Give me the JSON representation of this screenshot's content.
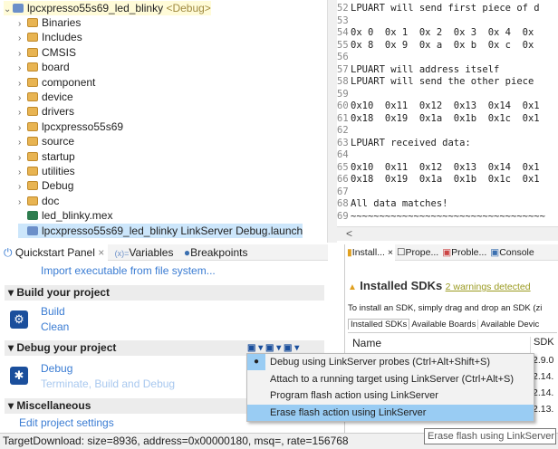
{
  "tree": {
    "project": "lpcxpresso55s69_led_blinky",
    "project_config": "<Debug>",
    "items": [
      {
        "label": "Binaries",
        "expandable": true
      },
      {
        "label": "Includes",
        "expandable": true
      },
      {
        "label": "CMSIS",
        "expandable": true
      },
      {
        "label": "board",
        "expandable": true
      },
      {
        "label": "component",
        "expandable": true
      },
      {
        "label": "device",
        "expandable": true
      },
      {
        "label": "drivers",
        "expandable": true
      },
      {
        "label": "lpcxpresso55s69",
        "expandable": true
      },
      {
        "label": "source",
        "expandable": true
      },
      {
        "label": "startup",
        "expandable": true
      },
      {
        "label": "utilities",
        "expandable": true
      },
      {
        "label": "Debug",
        "expandable": true
      },
      {
        "label": "doc",
        "expandable": true
      },
      {
        "label": "led_blinky.mex",
        "expandable": false
      },
      {
        "label": "lpcxpresso55s69_led_blinky LinkServer Debug.launch",
        "expandable": false,
        "selected": true
      }
    ]
  },
  "editor": {
    "lines": [
      {
        "n": "52",
        "t": "LPUART will send first piece of d"
      },
      {
        "n": "53",
        "t": ""
      },
      {
        "n": "54",
        "t": "0x 0  0x 1  0x 2  0x 3  0x 4  0x"
      },
      {
        "n": "55",
        "t": "0x 8  0x 9  0x a  0x b  0x c  0x"
      },
      {
        "n": "56",
        "t": ""
      },
      {
        "n": "57",
        "t": "LPUART will address itself"
      },
      {
        "n": "58",
        "t": "LPUART will send the other piece"
      },
      {
        "n": "59",
        "t": ""
      },
      {
        "n": "60",
        "t": "0x10  0x11  0x12  0x13  0x14  0x1"
      },
      {
        "n": "61",
        "t": "0x18  0x19  0x1a  0x1b  0x1c  0x1"
      },
      {
        "n": "62",
        "t": ""
      },
      {
        "n": "63",
        "t": "LPUART received data:"
      },
      {
        "n": "64",
        "t": ""
      },
      {
        "n": "65",
        "t": "0x10  0x11  0x12  0x13  0x14  0x1"
      },
      {
        "n": "66",
        "t": "0x18  0x19  0x1a  0x1b  0x1c  0x1"
      },
      {
        "n": "67",
        "t": ""
      },
      {
        "n": "68",
        "t": "All data matches!"
      },
      {
        "n": "69",
        "t": "~~~~~~~~~~~~~~~~~~~~~~~~~~~~~~~~~~"
      }
    ]
  },
  "quickstart": {
    "tabs": [
      "Quickstart Panel",
      "Variables",
      "Breakpoints"
    ],
    "import_link": "Import executable from file system...",
    "build_section": "Build your project",
    "build": "Build",
    "clean": "Clean",
    "debug_section": "Debug your project",
    "debug": "Debug",
    "terminate": "Terminate, Build and Debug",
    "misc_section": "Miscellaneous",
    "edit_settings": "Edit project settings"
  },
  "right": {
    "tabs": [
      "Install...",
      "Prope...",
      "Proble...",
      "Console"
    ],
    "title": "Installed SDKs",
    "warnings": "2 warnings detected",
    "hint": "To install an SDK, simply drag and drop an SDK (zi",
    "subtabs": [
      "Installed SDKs",
      "Available Boards",
      "Available Devic"
    ],
    "col_name": "Name",
    "col_sdk": "SDK",
    "versions": [
      "2.9.0",
      "2.14.",
      "2.14.",
      "2.13."
    ]
  },
  "menu": {
    "items": [
      "Debug using LinkServer probes (Ctrl+Alt+Shift+S)",
      "Attach to a running target using LinkServer (Ctrl+Alt+S)",
      "Program flash action using LinkServer",
      "Erase flash action using LinkServer"
    ]
  },
  "tooltip": "Erase flash using LinkServer",
  "status": "TargetDownload: size=8936, address=0x00000180, msq=, rate=156768"
}
